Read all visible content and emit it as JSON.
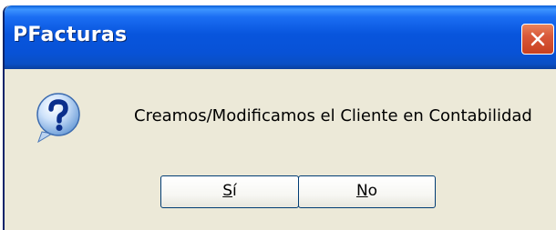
{
  "dialog": {
    "title": "PFacturas",
    "message": "Creamos/Modificamos el Cliente en Contabilidad",
    "icon": "question-icon",
    "buttons": {
      "yes": {
        "mnemonic": "S",
        "rest": "í"
      },
      "no": {
        "mnemonic": "N",
        "rest": "o"
      }
    }
  },
  "colors": {
    "title_bar": "#0855dd",
    "window_bg": "#ece9d8",
    "close_button": "#d9583a",
    "button_border": "#003c74"
  }
}
